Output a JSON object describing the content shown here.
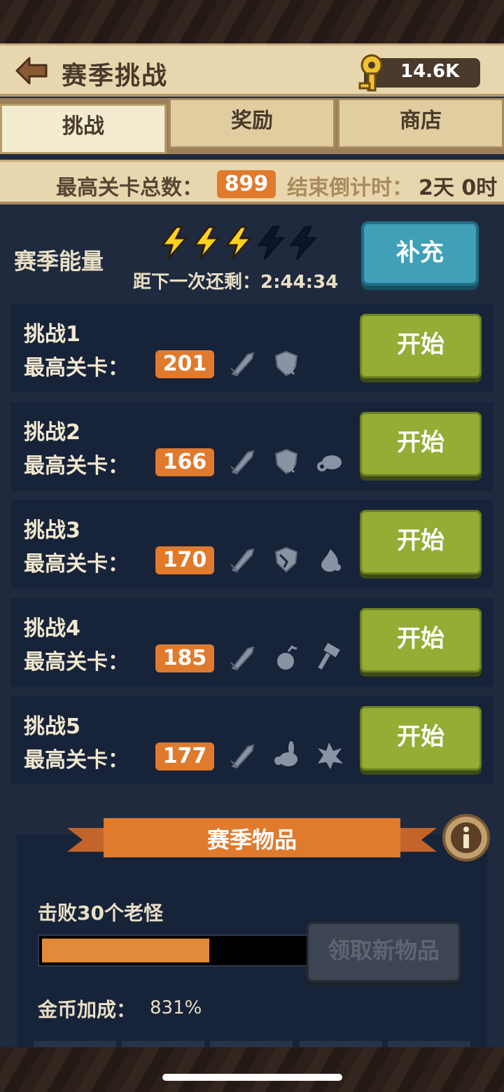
{
  "header": {
    "title": "赛季挑战",
    "key_count": "14.6K"
  },
  "tabs": [
    {
      "label": "挑战",
      "active": true
    },
    {
      "label": "奖励",
      "active": false
    },
    {
      "label": "商店",
      "active": false
    }
  ],
  "stats": {
    "max_levels_label": "最高关卡总数：",
    "max_levels_value": "899",
    "countdown_label": "结束倒计时：",
    "countdown_value": "2天 0时"
  },
  "energy": {
    "label": "赛季能量",
    "filled": 3,
    "total": 5,
    "timer_text": "距下一次还剩：2:44:34",
    "refill_label": "补充"
  },
  "challenges": [
    {
      "title": "挑战1",
      "best_label": "最高关卡：",
      "best_value": "201",
      "icons": [
        "sword-icon",
        "shield-icon"
      ],
      "start_label": "开始"
    },
    {
      "title": "挑战2",
      "best_label": "最高关卡：",
      "best_value": "166",
      "icons": [
        "sword-icon",
        "shield-icon",
        "turtle-icon"
      ],
      "start_label": "开始"
    },
    {
      "title": "挑战3",
      "best_label": "最高关卡：",
      "best_value": "170",
      "icons": [
        "sword-icon",
        "cracked-shield-icon",
        "fire-icon"
      ],
      "start_label": "开始"
    },
    {
      "title": "挑战4",
      "best_label": "最高关卡：",
      "best_value": "185",
      "icons": [
        "sword-icon",
        "bomb-icon",
        "hammer-icon"
      ],
      "start_label": "开始"
    },
    {
      "title": "挑战5",
      "best_label": "最高关卡：",
      "best_value": "177",
      "icons": [
        "sword-icon",
        "rabbit-icon",
        "burst-icon"
      ],
      "start_label": "开始"
    }
  ],
  "season_items": {
    "title": "赛季物品",
    "boss_text": "击败30个老怪",
    "progress": 0.61,
    "claim_label": "领取新物品",
    "coin_bonus_label": "金币加成：",
    "coin_bonus_value": "831%"
  },
  "colors": {
    "accent_orange": "#e07a2d",
    "start_green": "#93ad35",
    "refill_blue": "#3fa0b8",
    "panel_dark": "#172339",
    "parchment": "#e8d7ae"
  }
}
